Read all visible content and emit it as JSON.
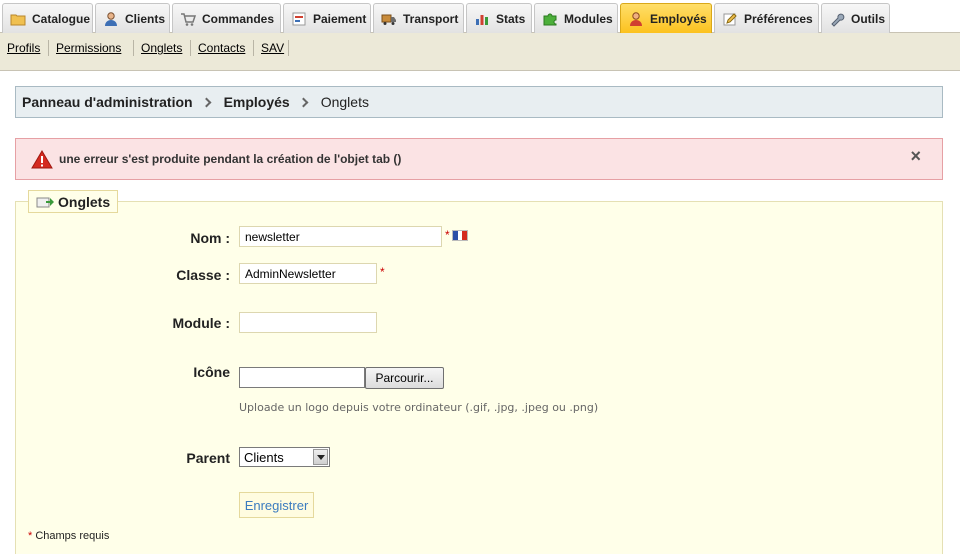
{
  "tabs": [
    {
      "name": "tab-catalogue",
      "label": "Catalogue",
      "icon": "folder-icon",
      "active": false
    },
    {
      "name": "tab-clients",
      "label": "Clients",
      "icon": "user-icon",
      "active": false
    },
    {
      "name": "tab-commandes",
      "label": "Commandes",
      "icon": "cart-icon",
      "active": false
    },
    {
      "name": "tab-paiement",
      "label": "Paiement",
      "icon": "payment-icon",
      "active": false
    },
    {
      "name": "tab-transport",
      "label": "Transport",
      "icon": "truck-icon",
      "active": false
    },
    {
      "name": "tab-stats",
      "label": "Stats",
      "icon": "chart-icon",
      "active": false
    },
    {
      "name": "tab-modules",
      "label": "Modules",
      "icon": "puzzle-icon",
      "active": false
    },
    {
      "name": "tab-employes",
      "label": "Employés",
      "icon": "employee-icon",
      "active": true
    },
    {
      "name": "tab-preferences",
      "label": "Préférences",
      "icon": "pencil-icon",
      "active": false
    },
    {
      "name": "tab-outils",
      "label": "Outils",
      "icon": "wrench-icon",
      "active": false
    }
  ],
  "subnav": [
    "Profils",
    "Permissions",
    "Onglets",
    "Contacts",
    "SAV"
  ],
  "breadcrumb": {
    "root": "Panneau d'administration",
    "section": "Employés",
    "current": "Onglets"
  },
  "error": {
    "icon": "warning-icon",
    "message": "une erreur s'est produite pendant la création de l'objet tab ()",
    "close": "×"
  },
  "form": {
    "legend": "Onglets",
    "legend_icon": "tab-add-icon",
    "nom_label": "Nom :",
    "nom_value": "newsletter",
    "classe_label": "Classe :",
    "classe_value": "AdminNewsletter",
    "module_label": "Module :",
    "module_value": "",
    "icone_label": "Icône",
    "browse_label": "Parcourir...",
    "icone_hint": "Uploade un logo depuis votre ordinateur (.gif, .jpg, .jpeg ou .png)",
    "parent_label": "Parent",
    "parent_value": "Clients",
    "save_label": "Enregistrer",
    "required_mark": "*",
    "footnote": "Champs requis"
  },
  "colors": {
    "active_tab": "#fcc21e",
    "error_bg": "#fbe3e4",
    "form_bg": "#ffffe9",
    "breadcrumb_bg": "#e8eef1",
    "link": "#3b7bbf"
  }
}
